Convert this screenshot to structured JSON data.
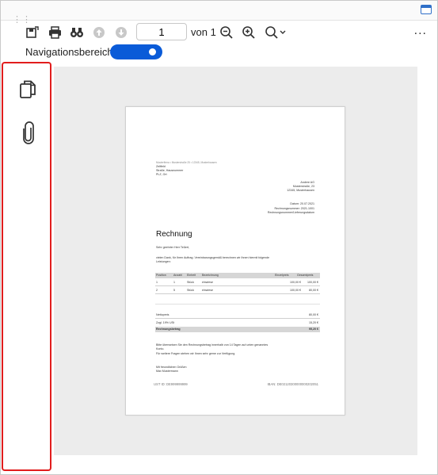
{
  "toolbar": {
    "page_value": "1",
    "of_label": "von 1",
    "more_label": "...",
    "icons": [
      "save-icon",
      "print-icon",
      "find-icon",
      "previous-page-icon",
      "next-page-icon",
      "zoom-out-icon",
      "zoom-in-icon",
      "zoom-menu-icon"
    ]
  },
  "nav": {
    "label": "Navigationsbereich",
    "toggle_on": true,
    "accent": "#0a5bd8"
  },
  "sidebar": {
    "highlight_color": "#e11d1d",
    "icons": [
      "pages-icon",
      "attachment-icon"
    ]
  },
  "document": {
    "sender_line": "Musterfirma • Musterstraße 25 • 12345, Musterhausen",
    "recipient": [
      "Zeltfeld",
      "Straße, Hausnummer",
      "PLZ, Ort"
    ],
    "company": [
      "Andere AG",
      "Musterstraße, 23",
      "12345, Musterhausen"
    ],
    "meta": [
      "Datum: 20.07.2021",
      "Rechnungsnummer: 2021-1001",
      "Rechnungsnummer/Lieferungsdatum"
    ],
    "title": "Rechnung",
    "salutation": "Sehr geehrter Herr Teßert,",
    "intro": "vielen Dank, für Ihren Auftrag. Vereinbarungsgemäß berechnen wir Ihnen hiermit folgende",
    "intro2": "Leistungen:",
    "table_headers": [
      "Position",
      "Anzahl",
      "Einheit",
      "Bezeichnung",
      "Einzelpreis",
      "Gesamtpreis"
    ],
    "table_rows": [
      [
        "1",
        "1",
        "Stück",
        "einwiese",
        "100,00 €",
        "100,00 €"
      ],
      [
        "2",
        "5",
        "Stück",
        "einwiese",
        "100,00 €",
        "80,00 €"
      ]
    ],
    "totals": [
      {
        "label": "Nettopreis",
        "value": "80,00 €"
      },
      {
        "label": "Zzgl. 19% USt",
        "value": "15,20 €"
      },
      {
        "label": "Rechnungsbetrag",
        "value": "95,20 €"
      }
    ],
    "closing": [
      "Bitte überweisen Sie den Rechnungsbetrag innerhalb von 14 Tagen auf unten genanntes",
      "Konto.",
      "Für weitere Fragen stehen wir Ihnen sehr gerne zur Verfügung."
    ],
    "signature": [
      "Mit freundlichen Grüßen",
      "Max Mustermann"
    ],
    "footer_left": "UST ID: DE999999999",
    "footer_right": "IBAN: DE02120300000000202051"
  }
}
